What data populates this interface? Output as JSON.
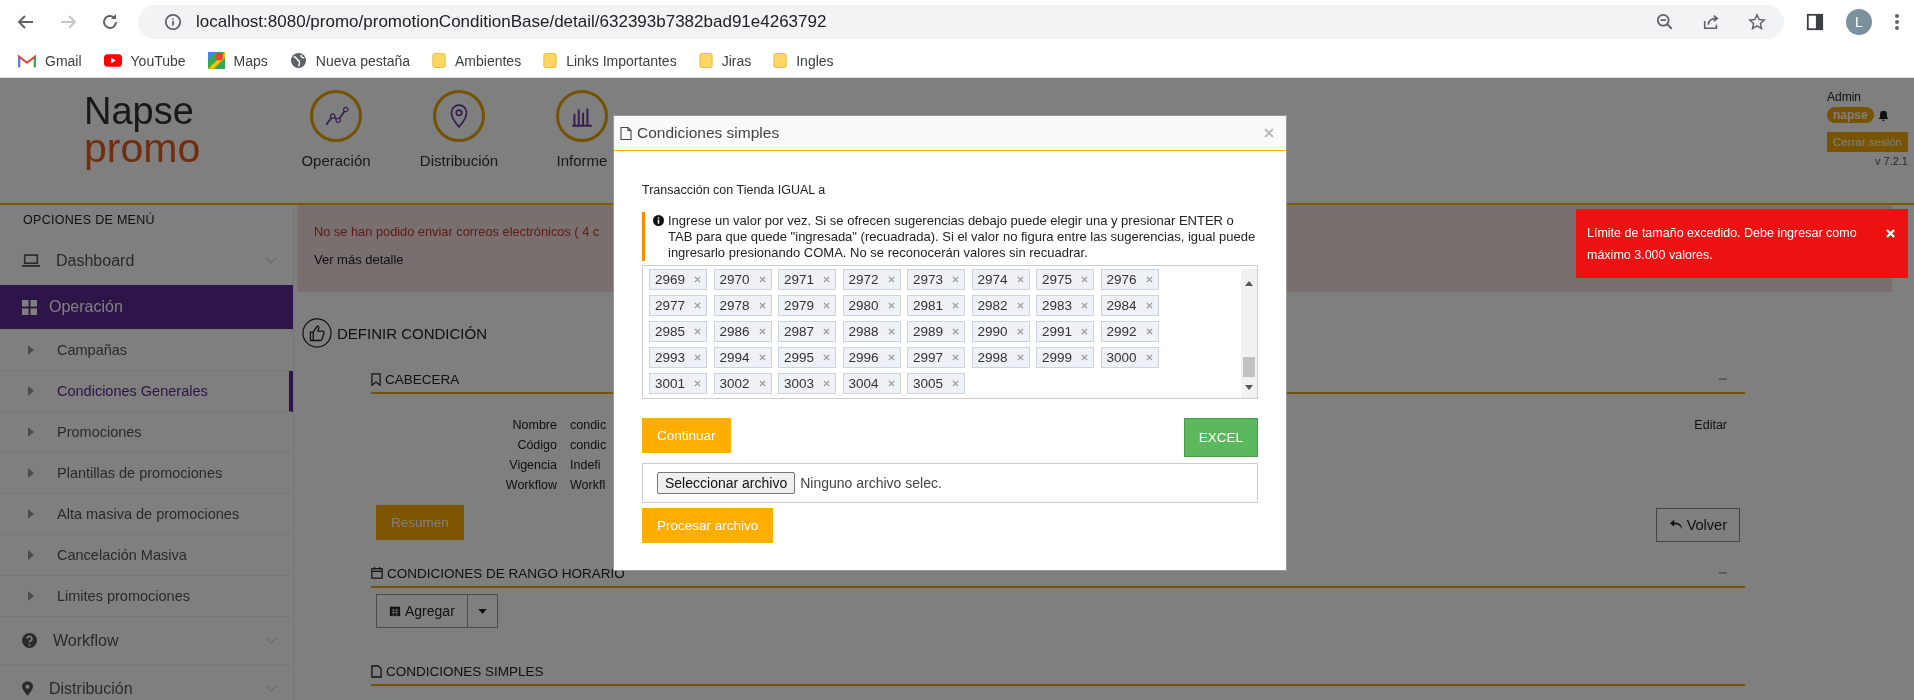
{
  "browser": {
    "nav_buttons": [
      {
        "kind": "back",
        "disabled": false
      },
      {
        "kind": "forward",
        "disabled": true
      },
      {
        "kind": "reload",
        "disabled": false
      }
    ],
    "url": "localhost:8080/promo/promotionConditionBase/detail/632393b7382bad91e4263792",
    "avatar": "L",
    "bookmarks": [
      {
        "kind": "gmail",
        "label": "Gmail"
      },
      {
        "kind": "youtube",
        "label": "YouTube"
      },
      {
        "kind": "maps",
        "label": "Maps"
      },
      {
        "kind": "globe",
        "label": "Nueva pestaña"
      },
      {
        "kind": "folder",
        "label": "Ambientes"
      },
      {
        "kind": "folder",
        "label": "Links Importantes"
      },
      {
        "kind": "folder",
        "label": "Jiras"
      },
      {
        "kind": "folder",
        "label": "Ingles"
      }
    ]
  },
  "header": {
    "logo_top": "Napse",
    "logo_bottom": "promo",
    "nav": [
      {
        "kind": "chart",
        "label": "Operación"
      },
      {
        "kind": "pin",
        "label": "Distribución"
      },
      {
        "kind": "bars",
        "label": "Informe"
      }
    ],
    "user": "Admin",
    "tenant": "napse",
    "logout": "Cerrar sesión",
    "version": "v 7.2.1"
  },
  "sidebar": {
    "heading": "OPCIONES DE MENÚ",
    "items": [
      {
        "kind": "laptop",
        "label": "Dashboard",
        "selected": false,
        "expanded": false
      },
      {
        "kind": "grid",
        "label": "Operación",
        "selected": true,
        "expanded": true,
        "children": [
          {
            "label": "Campañas",
            "selected": false
          },
          {
            "label": "Condiciones Generales",
            "selected": true
          },
          {
            "label": "Promociones",
            "selected": false
          },
          {
            "label": "Plantillas de promociones",
            "selected": false
          },
          {
            "label": "Alta masiva de promociones",
            "selected": false
          },
          {
            "label": "Cancelación Masiva",
            "selected": false
          },
          {
            "label": "Limites promociones",
            "selected": false
          }
        ]
      },
      {
        "kind": "question",
        "label": "Workflow",
        "selected": false,
        "expanded": false
      },
      {
        "kind": "pin",
        "label": "Distribución",
        "selected": false,
        "expanded": false
      }
    ]
  },
  "alert": {
    "message": "No se han podido enviar correos electrónicos ( 4 c",
    "link": "Ver más detalle"
  },
  "page_title": "DEFINIR CONDICIÓN",
  "header_section": {
    "title": "CABECERA",
    "fields": [
      {
        "label": "Nombre",
        "value": "condic"
      },
      {
        "label": "Código",
        "value": "condic"
      },
      {
        "label": "Vigencia",
        "value": "Indefi"
      },
      {
        "label": "Workflow",
        "value": "Workfl"
      }
    ],
    "edit_link": "Editar",
    "summary_button": "Resumen",
    "back_button": "Volver"
  },
  "time_section": {
    "title": "CONDICIONES DE RANGO HORARIO",
    "add_button": "Agregar"
  },
  "simple_section": {
    "title": "CONDICIONES SIMPLES"
  },
  "modal": {
    "title": "Condiciones simples",
    "subtitle": "Transacción con Tienda IGUAL a",
    "note": "Ingrese un valor por vez. Si se ofrecen sugerencias debajo puede elegir una y presionar ENTER o TAB para que quede \"ingresada\" (recuadrada). Si el valor no figura entre las sugerencias, igual puede ingresarlo presionando COMA. No se reconocerán valores sin recuadrar.",
    "tags": [
      "2969",
      "2970",
      "2971",
      "2972",
      "2973",
      "2974",
      "2975",
      "2976",
      "2977",
      "2978",
      "2979",
      "2980",
      "2981",
      "2982",
      "2983",
      "2984",
      "2985",
      "2986",
      "2987",
      "2988",
      "2989",
      "2990",
      "2991",
      "2992",
      "2993",
      "2994",
      "2995",
      "2996",
      "2997",
      "2998",
      "2999",
      "3000",
      "3001",
      "3002",
      "3003",
      "3004",
      "3005"
    ],
    "continue_button": "Continuar",
    "excel_button": "EXCEL",
    "file_button": "Seleccionar archivo",
    "file_status": "Ninguno archivo selec.",
    "process_button": "Procesar archivo"
  },
  "toast": {
    "message": "Límite de tamaño excedido. Debe ingresar como máximo 3.000 valores."
  }
}
